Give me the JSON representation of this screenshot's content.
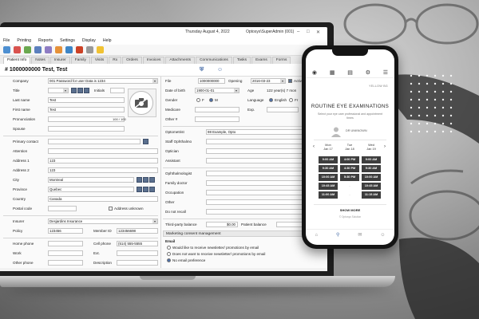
{
  "app": {
    "date": "Thursday August 4, 2022",
    "user": "Optosys\\SuperAdmin (001)",
    "menu": [
      "File",
      "Printing",
      "Reports",
      "Settings",
      "Display",
      "Help"
    ],
    "tabs": [
      "Patient Info",
      "Notes",
      "Insurer",
      "Family",
      "Visits",
      "Rx",
      "Orders",
      "Invoices",
      "Attachments",
      "Communications",
      "Tasks",
      "Exams",
      "Forms"
    ],
    "patient_header": "# 1000000000  Test, Test",
    "left": {
      "company_label": "Company",
      "company_value": "001 Password for user Data is 1234",
      "title_label": "Title",
      "initials_label": "Initials",
      "lastname_label": "Last name",
      "lastname_value": "Test",
      "firstname_label": "First name",
      "firstname_value": "Test",
      "pronunciation_label": "Pronunciation",
      "pronunciation_count": "100 / 100",
      "spouse_label": "Spouse",
      "primary_contact_label": "Primary contact",
      "attention_label": "Attention",
      "address1_label": "Address 1",
      "address1_value": "123",
      "address2_label": "Address 2",
      "address2_value": "123",
      "city_label": "City",
      "city_value": "Montreal",
      "province_label": "Province",
      "province_value": "Quebec",
      "country_label": "Country",
      "country_value": "Canada",
      "postal_label": "Postal code",
      "address_unknown_label": "Address unknown",
      "insurer_label": "Insurer",
      "insurer_value": "Desjardins Insurance",
      "policy_label": "Policy",
      "policy_value": "123456",
      "memberid_label": "Member ID",
      "memberid_value": "123456698",
      "homephone_label": "Home phone",
      "cellphone_label": "Cell phone",
      "cellphone_value": "(514) 555-5555",
      "work_label": "Work",
      "ext_label": "Ext.",
      "otherphone_label": "Other phone",
      "description_label": "Description"
    },
    "right": {
      "file_label": "File",
      "file_value": "1000000000",
      "opening_label": "Opening",
      "opening_value": "2016-03-23",
      "active_label": "Activ",
      "dob_label": "Date of birth",
      "dob_value": "1900-01-01",
      "age_label": "Age",
      "age_value": "122 year(s) 7 mon",
      "gender_label": "Gender",
      "gender_f": "F",
      "gender_m": "M",
      "language_label": "Language",
      "language_english": "English",
      "language_fr": "Fr",
      "medicare_label": "Medicare",
      "exp_label": "Exp.",
      "other_label": "Other #",
      "optometrist_label": "Optometrist",
      "optometrist_value": "98 Example, Opto",
      "staff_label": "Staff Ophthalmo",
      "optician_label": "Optician",
      "assistant_label": "Assistant",
      "ophthalmologist_label": "Ophthalmologist",
      "family_doctor_label": "Family doctor",
      "occupation_label": "Occupation",
      "other2_label": "Other",
      "donotrecall_label": "Do not recall",
      "thirdparty_label": "Third-party balance",
      "thirdparty_value": "$0.00",
      "patient_balance_label": "Patient balance",
      "marketing_header": "Marketing consent management",
      "email_header": "Email",
      "consent_yes": "Would like to receive newsletter/ promotions by email",
      "consent_no": "Does not want to receive newsletter/ promotions by email",
      "consent_none": "No email preference"
    }
  },
  "phone": {
    "logo": "YELLOW BG",
    "title": "ROUTINE EYE EXAMINATIONS",
    "subtitle": "Select your eye care professional and appointment times",
    "doctor": "DR UNKNOWN",
    "days": [
      {
        "name": "Mon",
        "date": "Jan 17"
      },
      {
        "name": "Tue",
        "date": "Jan 18"
      },
      {
        "name": "Wed",
        "date": "Jan 19"
      }
    ],
    "slots": [
      [
        "9:00 AM",
        "4:00 PM",
        "9:00 AM"
      ],
      [
        "9:30 AM",
        "4:30 PM",
        "9:30 AM"
      ],
      [
        "10:00 AM",
        "5:30 PM",
        "10:00 AM"
      ],
      [
        "10:45 AM",
        "-",
        "10:45 AM"
      ],
      [
        "11:00 AM",
        "-",
        "11:15 AM"
      ]
    ],
    "show_more": "SHOW MORE",
    "footer": "© Optosys Solution"
  },
  "colors": {
    "accent": "#4a6ea8",
    "slot": "#3e3e3e"
  }
}
